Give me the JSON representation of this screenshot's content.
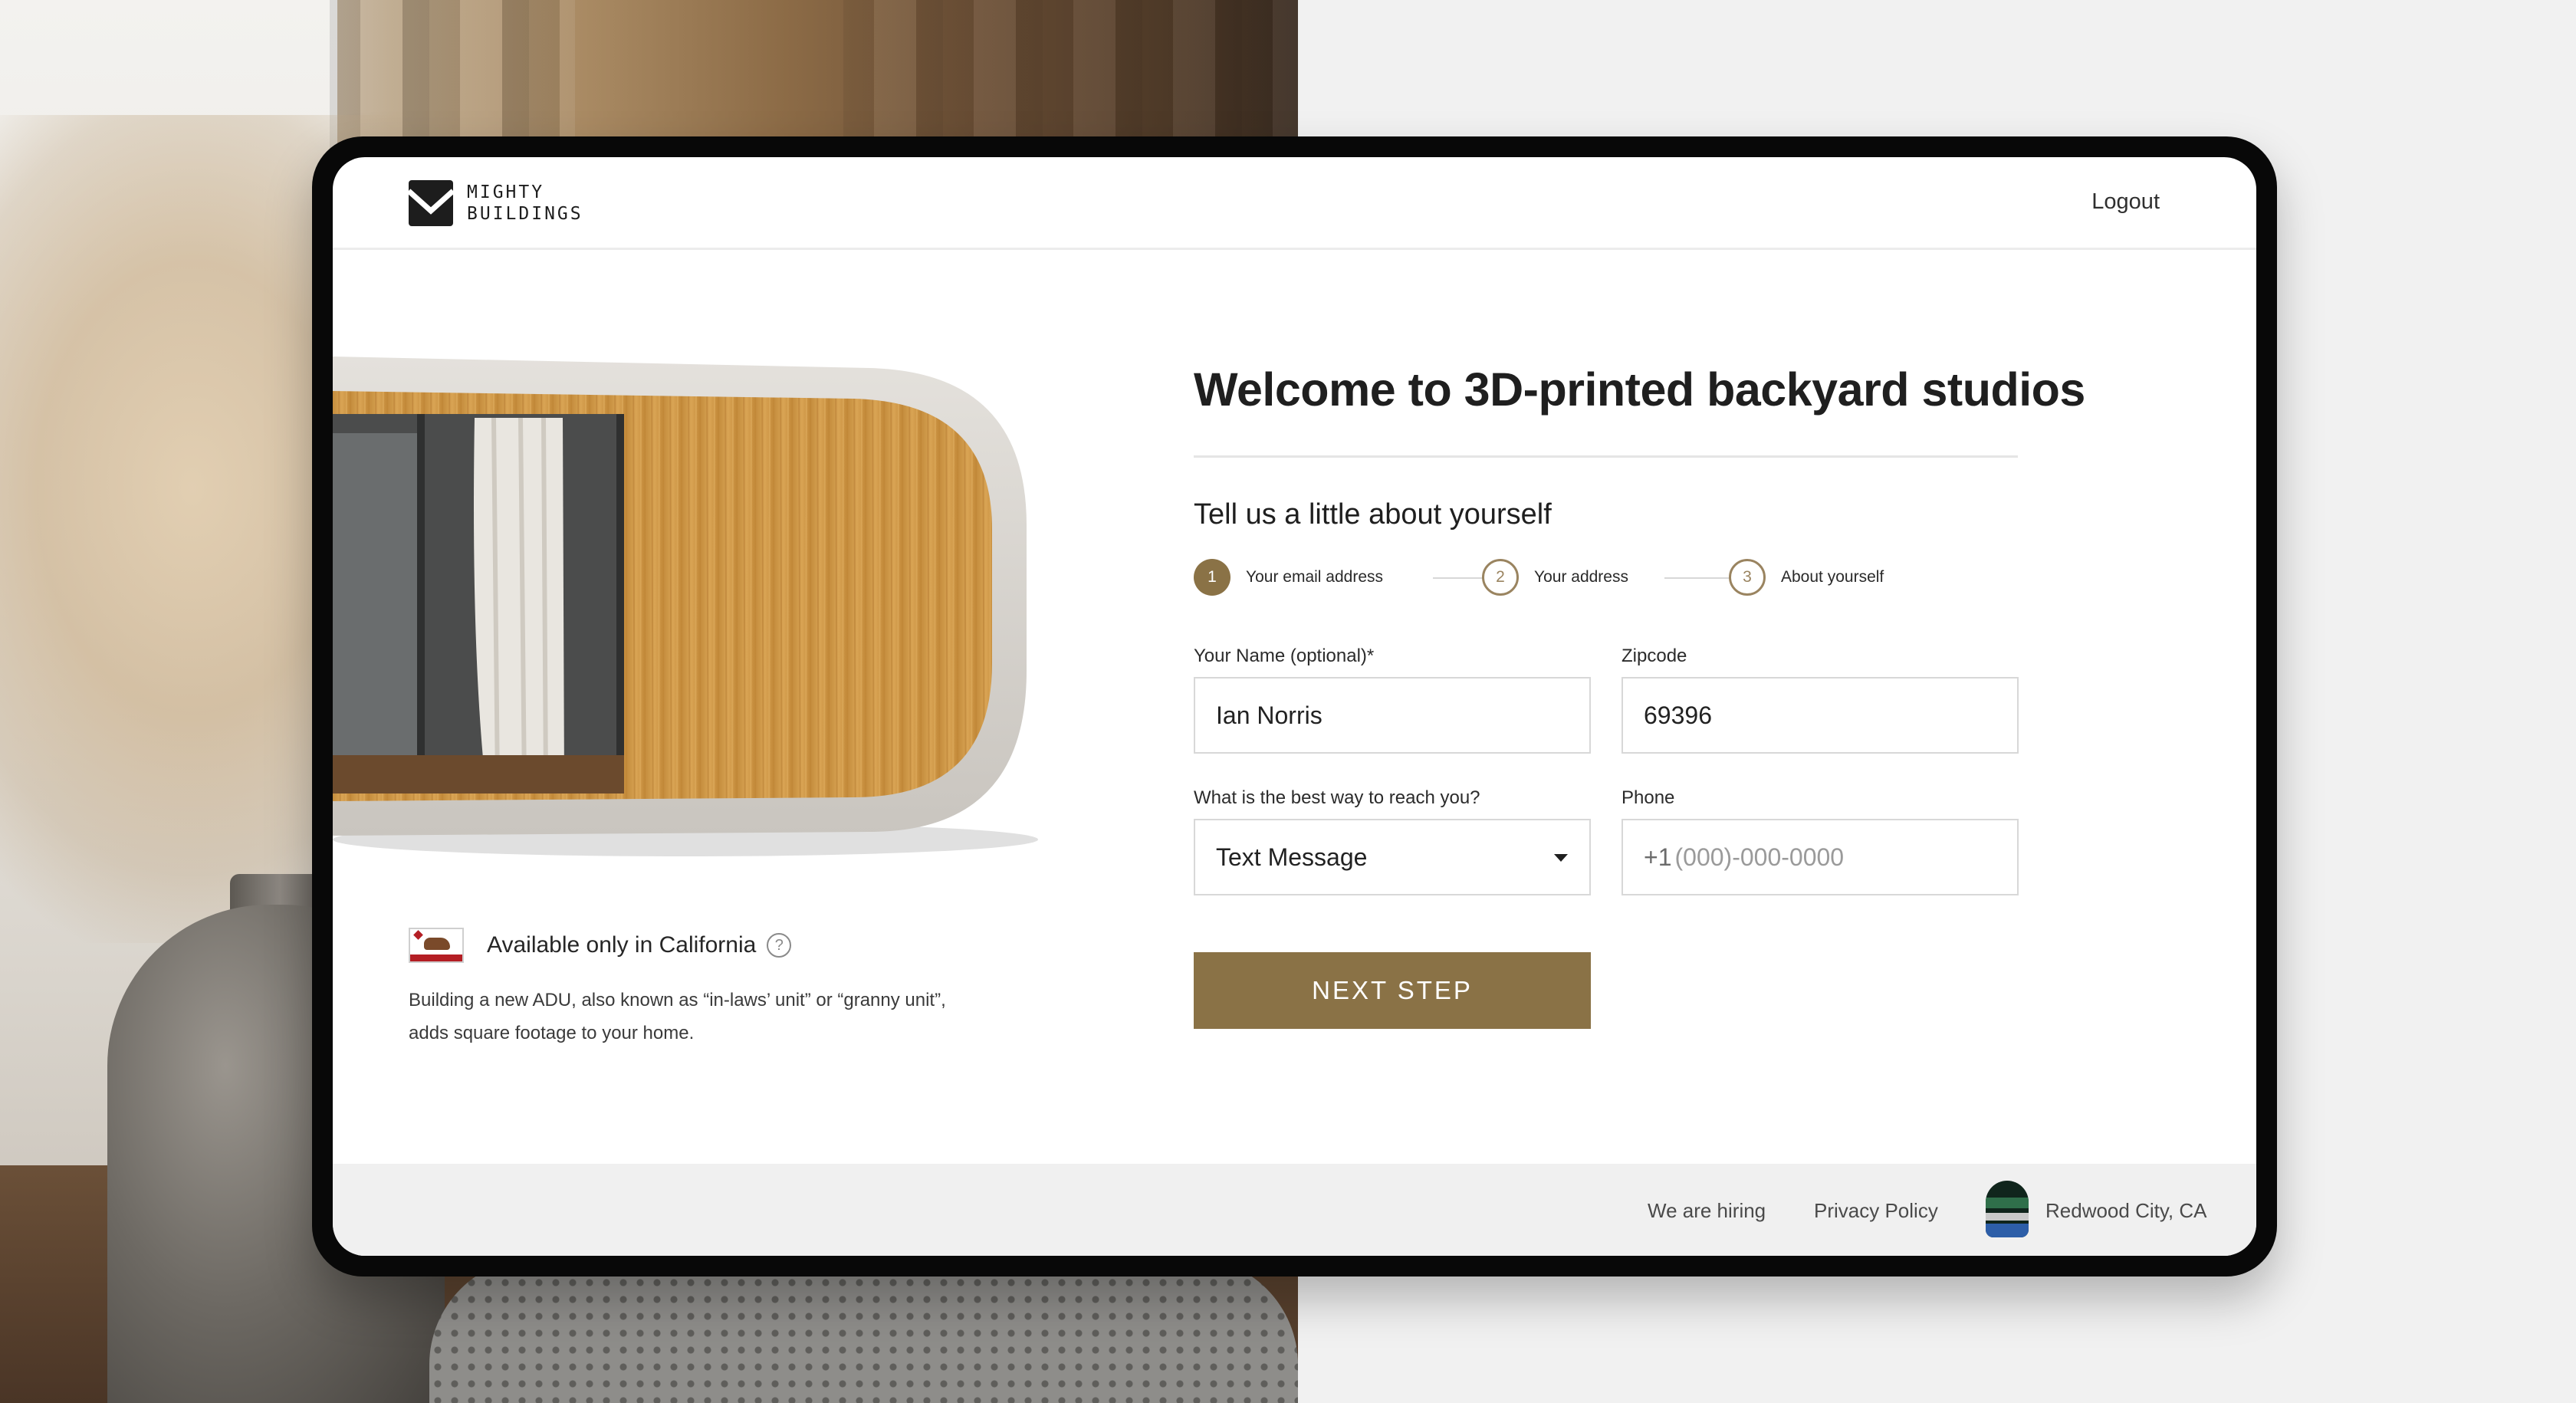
{
  "header": {
    "logo_text": "MIGHTY\nBUILDINGS",
    "logout_label": "Logout"
  },
  "hero": {
    "availability_text": "Available only in California",
    "help_icon_glyph": "?",
    "description": "Building a new ADU, also known as “in-laws’ unit” or “granny unit”, adds square footage to your home."
  },
  "form": {
    "title": "Welcome to 3D-printed backyard studios",
    "subtitle": "Tell us a little about yourself",
    "steps": [
      {
        "number": "1",
        "label": "Your email address",
        "active": true
      },
      {
        "number": "2",
        "label": "Your address",
        "active": false
      },
      {
        "number": "3",
        "label": "About yourself",
        "active": false
      }
    ],
    "name": {
      "label": "Your Name (optional)*",
      "value": "Ian Norris"
    },
    "zipcode": {
      "label": "Zipcode",
      "value": "69396"
    },
    "contact_method": {
      "label": "What is the best way to reach you?",
      "value": "Text Message"
    },
    "phone": {
      "label": "Phone",
      "prefix": "+1",
      "placeholder": "(000)-000-0000"
    },
    "next_label": "NEXT STEP"
  },
  "footer": {
    "hiring_label": "We are hiring",
    "privacy_label": "Privacy Policy",
    "location": "Redwood City, CA"
  },
  "colors": {
    "accent": "#8a7246",
    "footer_bg": "#f0f0f0",
    "device_frame": "#080808"
  },
  "icons": [
    "logo-icon",
    "california-flag-icon",
    "help-icon",
    "chevron-down-icon",
    "city-badge-icon"
  ]
}
